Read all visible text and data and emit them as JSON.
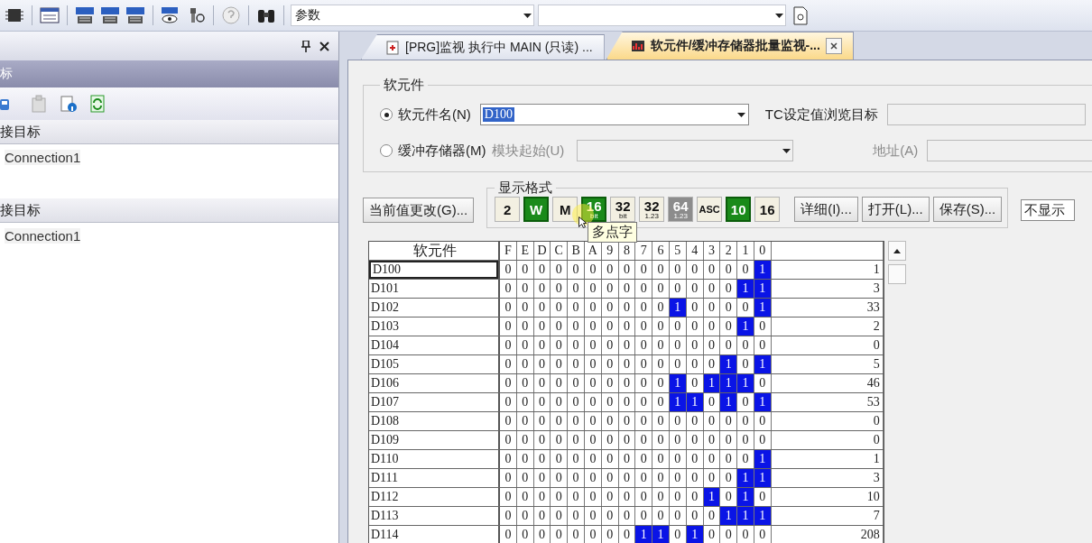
{
  "toolbar": {
    "search_combo": {
      "value": "参数"
    }
  },
  "left_panel": {
    "title_bar_text": "标",
    "sections": [
      {
        "header": "接目标",
        "items": [
          "Connection1"
        ]
      },
      {
        "header": "接目标",
        "items": [
          "Connection1"
        ]
      }
    ]
  },
  "tabs": [
    {
      "label": "[PRG]监视 执行中 MAIN (只读) ...",
      "selected": false,
      "closable": false
    },
    {
      "label": "软元件/缓冲存储器批量监视-...",
      "selected": true,
      "closable": true
    }
  ],
  "device_group": {
    "title": "软元件",
    "device_radio": {
      "label": "软元件名(N)",
      "selected": true
    },
    "device_name": {
      "value": "D100"
    },
    "tc_label": "TC设定值浏览目标",
    "buffer_radio": {
      "label": "缓冲存储器(M)",
      "selected": false
    },
    "module_label": "模块起始(U)",
    "address_label": "地址(A)"
  },
  "change_button": "当前值更改(G)...",
  "format_group": {
    "title": "显示格式",
    "buttons": [
      {
        "main": "2",
        "selected": false,
        "disabled": false
      },
      {
        "main": "W",
        "selected": true,
        "disabled": false
      },
      {
        "main": "M",
        "selected": false,
        "disabled": false
      },
      {
        "main": "16",
        "sub": "bit",
        "selected": true,
        "disabled": false
      },
      {
        "main": "32",
        "sub": "bit",
        "selected": false,
        "disabled": false
      },
      {
        "main": "32",
        "sub": "1.23",
        "selected": false,
        "disabled": false
      },
      {
        "main": "64",
        "sub": "1.23",
        "selected": false,
        "disabled": true
      },
      {
        "main": "ASC",
        "selected": false,
        "disabled": false
      },
      {
        "main": "10",
        "selected": true,
        "disabled": false
      },
      {
        "main": "16",
        "selected": false,
        "disabled": false
      }
    ]
  },
  "action_buttons": [
    "详细(I)...",
    "打开(L)...",
    "保存(S)..."
  ],
  "display_combo": {
    "value": "不显示"
  },
  "tooltip": "多点字",
  "table": {
    "header": "软元件",
    "bit_columns": [
      "F",
      "E",
      "D",
      "C",
      "B",
      "A",
      "9",
      "8",
      "7",
      "6",
      "5",
      "4",
      "3",
      "2",
      "1",
      "0"
    ],
    "rows": [
      {
        "device": "D100",
        "bits": [
          "0",
          "0",
          "0",
          "0",
          "0",
          "0",
          "0",
          "0",
          "0",
          "0",
          "0",
          "0",
          "0",
          "0",
          "0",
          "1"
        ],
        "value": "1",
        "focused": true
      },
      {
        "device": "D101",
        "bits": [
          "0",
          "0",
          "0",
          "0",
          "0",
          "0",
          "0",
          "0",
          "0",
          "0",
          "0",
          "0",
          "0",
          "0",
          "1",
          "1"
        ],
        "value": "3",
        "focused": false
      },
      {
        "device": "D102",
        "bits": [
          "0",
          "0",
          "0",
          "0",
          "0",
          "0",
          "0",
          "0",
          "0",
          "0",
          "1",
          "0",
          "0",
          "0",
          "0",
          "1"
        ],
        "value": "33",
        "focused": false
      },
      {
        "device": "D103",
        "bits": [
          "0",
          "0",
          "0",
          "0",
          "0",
          "0",
          "0",
          "0",
          "0",
          "0",
          "0",
          "0",
          "0",
          "0",
          "1",
          "0"
        ],
        "value": "2",
        "focused": false
      },
      {
        "device": "D104",
        "bits": [
          "0",
          "0",
          "0",
          "0",
          "0",
          "0",
          "0",
          "0",
          "0",
          "0",
          "0",
          "0",
          "0",
          "0",
          "0",
          "0"
        ],
        "value": "0",
        "focused": false
      },
      {
        "device": "D105",
        "bits": [
          "0",
          "0",
          "0",
          "0",
          "0",
          "0",
          "0",
          "0",
          "0",
          "0",
          "0",
          "0",
          "0",
          "1",
          "0",
          "1"
        ],
        "value": "5",
        "focused": false
      },
      {
        "device": "D106",
        "bits": [
          "0",
          "0",
          "0",
          "0",
          "0",
          "0",
          "0",
          "0",
          "0",
          "0",
          "1",
          "0",
          "1",
          "1",
          "1",
          "0"
        ],
        "value": "46",
        "focused": false
      },
      {
        "device": "D107",
        "bits": [
          "0",
          "0",
          "0",
          "0",
          "0",
          "0",
          "0",
          "0",
          "0",
          "0",
          "1",
          "1",
          "0",
          "1",
          "0",
          "1"
        ],
        "value": "53",
        "focused": false
      },
      {
        "device": "D108",
        "bits": [
          "0",
          "0",
          "0",
          "0",
          "0",
          "0",
          "0",
          "0",
          "0",
          "0",
          "0",
          "0",
          "0",
          "0",
          "0",
          "0"
        ],
        "value": "0",
        "focused": false
      },
      {
        "device": "D109",
        "bits": [
          "0",
          "0",
          "0",
          "0",
          "0",
          "0",
          "0",
          "0",
          "0",
          "0",
          "0",
          "0",
          "0",
          "0",
          "0",
          "0"
        ],
        "value": "0",
        "focused": false
      },
      {
        "device": "D110",
        "bits": [
          "0",
          "0",
          "0",
          "0",
          "0",
          "0",
          "0",
          "0",
          "0",
          "0",
          "0",
          "0",
          "0",
          "0",
          "0",
          "1"
        ],
        "value": "1",
        "focused": false
      },
      {
        "device": "D111",
        "bits": [
          "0",
          "0",
          "0",
          "0",
          "0",
          "0",
          "0",
          "0",
          "0",
          "0",
          "0",
          "0",
          "0",
          "0",
          "1",
          "1"
        ],
        "value": "3",
        "focused": false
      },
      {
        "device": "D112",
        "bits": [
          "0",
          "0",
          "0",
          "0",
          "0",
          "0",
          "0",
          "0",
          "0",
          "0",
          "0",
          "0",
          "1",
          "0",
          "1",
          "0"
        ],
        "value": "10",
        "focused": false
      },
      {
        "device": "D113",
        "bits": [
          "0",
          "0",
          "0",
          "0",
          "0",
          "0",
          "0",
          "0",
          "0",
          "0",
          "0",
          "0",
          "0",
          "1",
          "1",
          "1"
        ],
        "value": "7",
        "focused": false
      },
      {
        "device": "D114",
        "bits": [
          "0",
          "0",
          "0",
          "0",
          "0",
          "0",
          "0",
          "0",
          "1",
          "1",
          "0",
          "1",
          "0",
          "0",
          "0",
          "0"
        ],
        "value": "208",
        "focused": false
      }
    ]
  }
}
